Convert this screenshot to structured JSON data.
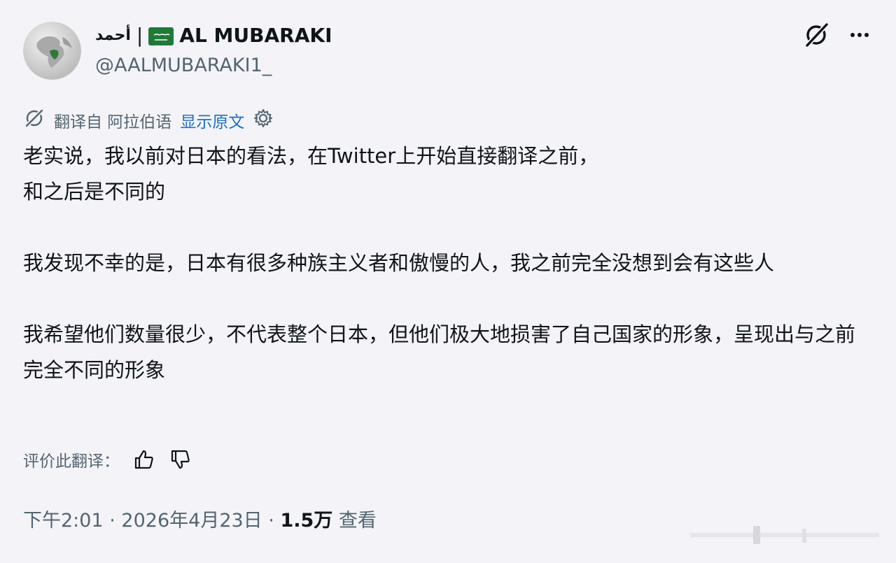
{
  "header": {
    "display_name_ar": "أحمد",
    "separator": "|",
    "display_name_en": "AL MUBARAKI",
    "handle": "@AALMUBARAKI1_",
    "flag_icon": "saudi-flag-icon"
  },
  "translation_bar": {
    "label": "翻译自 阿拉伯语",
    "show_original": "显示原文",
    "icon": "translate-icon",
    "settings_icon": "gear-icon"
  },
  "tweet": {
    "paragraphs": [
      "老实说，我以前对日本的看法，在Twitter上开始直接翻译之前，\n和之后是不同的",
      "我发现不幸的是，日本有很多种族主义者和傲慢的人，我之前完全没想到会有这些人",
      "我希望他们数量很少，不代表整个日本，但他们极大地损害了自己国家的形象，呈现出与之前完全不同的形象"
    ]
  },
  "rating": {
    "label": "评价此翻译："
  },
  "meta": {
    "time": "下午2:01",
    "date": "2026年4月23日",
    "dot": "·",
    "views_count": "1.5万",
    "views_label": "查看"
  },
  "colors": {
    "background": "#f4f4f8",
    "text": "#0f1419",
    "muted": "#536471",
    "link": "#1d6fc4",
    "flag_green": "#1f7a3a"
  }
}
